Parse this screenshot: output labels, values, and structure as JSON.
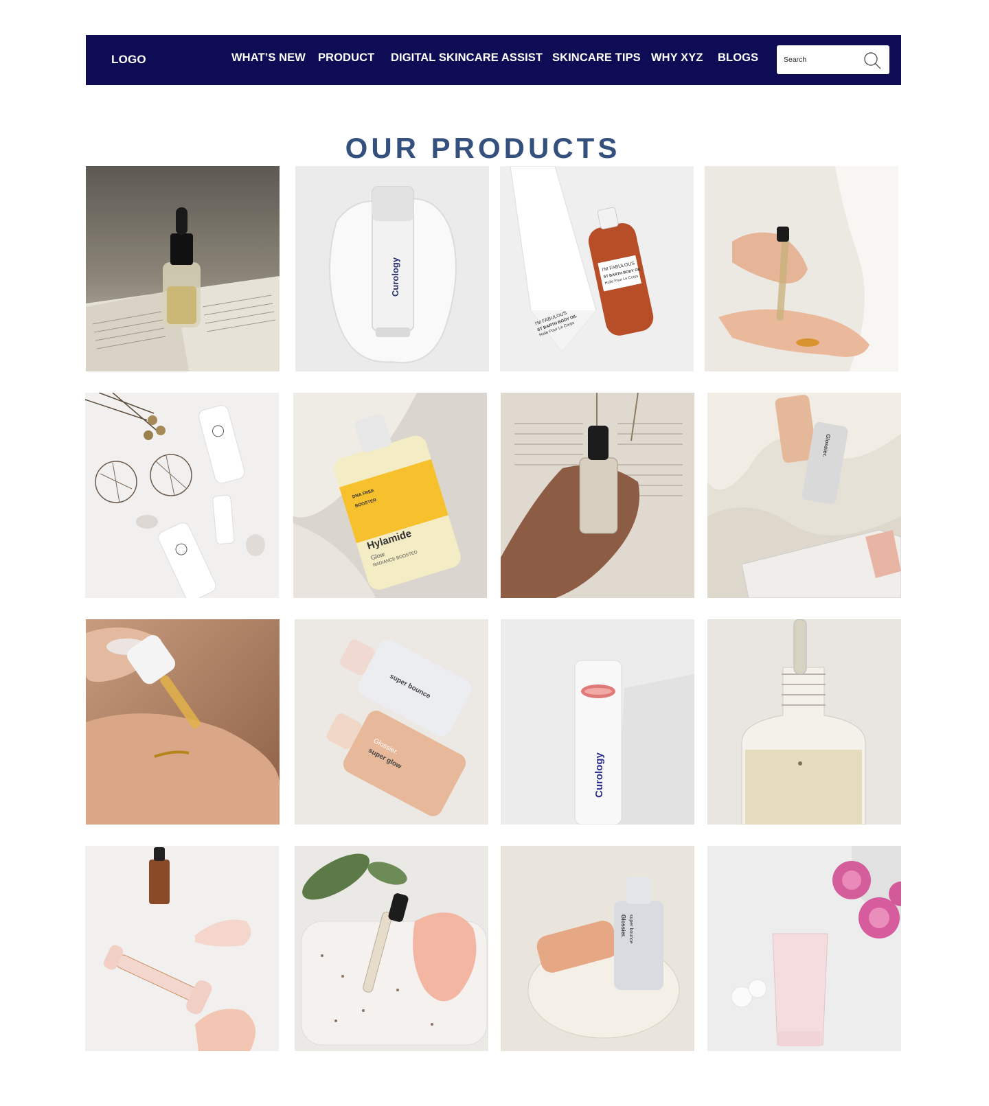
{
  "header": {
    "logo": "LOGO",
    "nav": [
      "WHAT’S NEW",
      "PRODUCT",
      "DIGITAL SKINCARE ASSIST",
      "SKINCARE TIPS",
      "WHY XYZ",
      "BLOGS"
    ],
    "search_placeholder": "Search",
    "search_icon": "search-icon"
  },
  "main": {
    "title": "OUR PRODUCTS"
  },
  "products": {
    "p2_brand": "Curology",
    "p3_label": [
      "I'M FABULOUS",
      "ST BARTH BODY OIL",
      "Huile Pour Le Corps"
    ],
    "p3_box_label": [
      "I'M FABULOUS",
      "ST BARTH BODY OIL",
      "Huile Pour Le Corps"
    ],
    "p6_label": [
      "DNA FREE",
      "BOOSTER",
      "Hylamide",
      "Glow",
      "RADIANCE BOOSTED"
    ],
    "p8_brand": "Glossier.",
    "p10_label": [
      "super bounce",
      "Glossier.",
      "super glow"
    ],
    "p11_brand": "Curology",
    "p15_label": [
      "Glossier.",
      "super bounce"
    ]
  },
  "colors": {
    "nav_bg": "#0f0c56",
    "title": "#34507f"
  }
}
